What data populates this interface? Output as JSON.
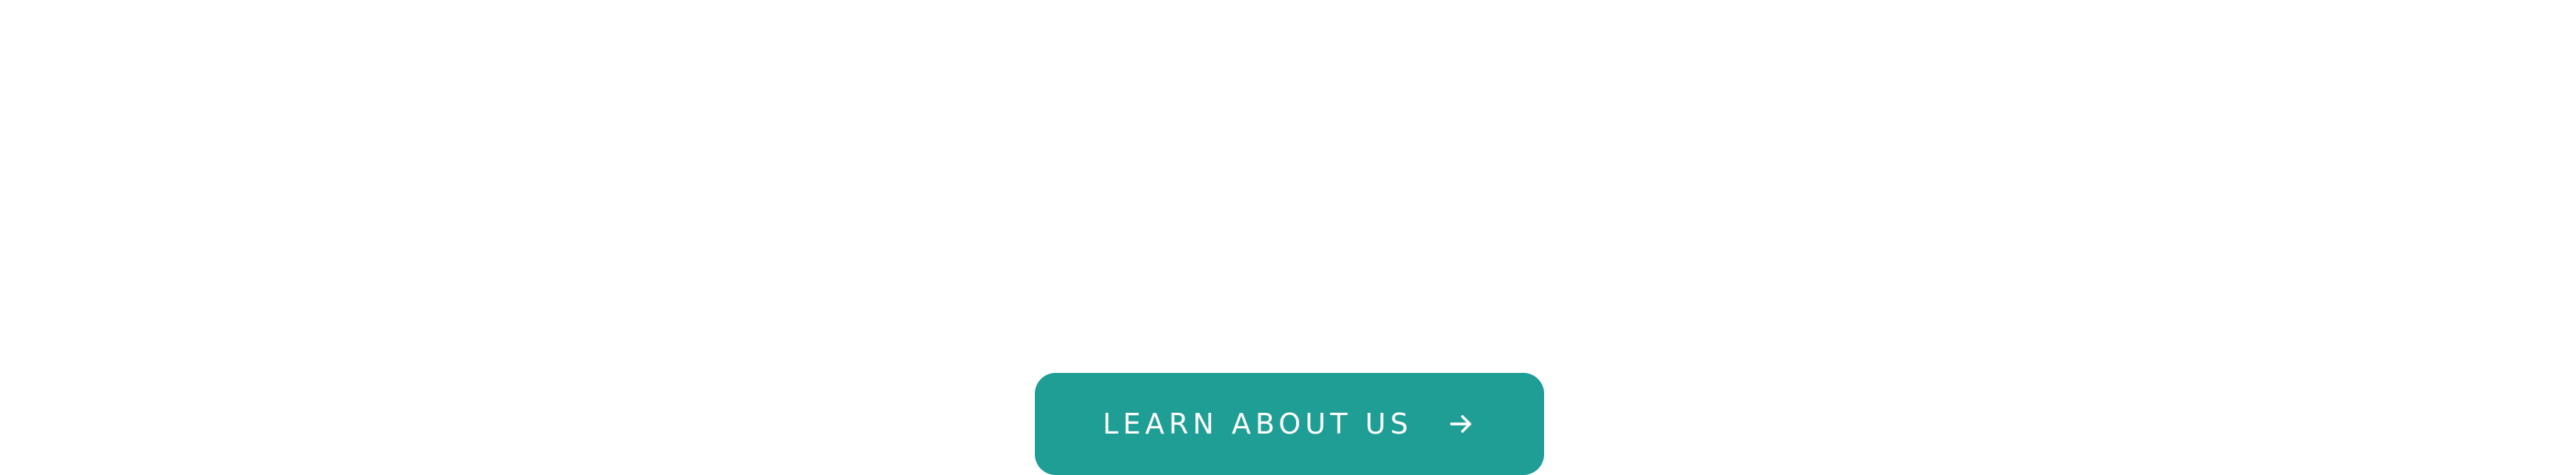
{
  "cta": {
    "label": "LEARN ABOUT US",
    "icon": "arrow-right-icon"
  },
  "colors": {
    "background": "#ffffff",
    "button": "#1f9e95",
    "button_text": "#ffffff"
  }
}
